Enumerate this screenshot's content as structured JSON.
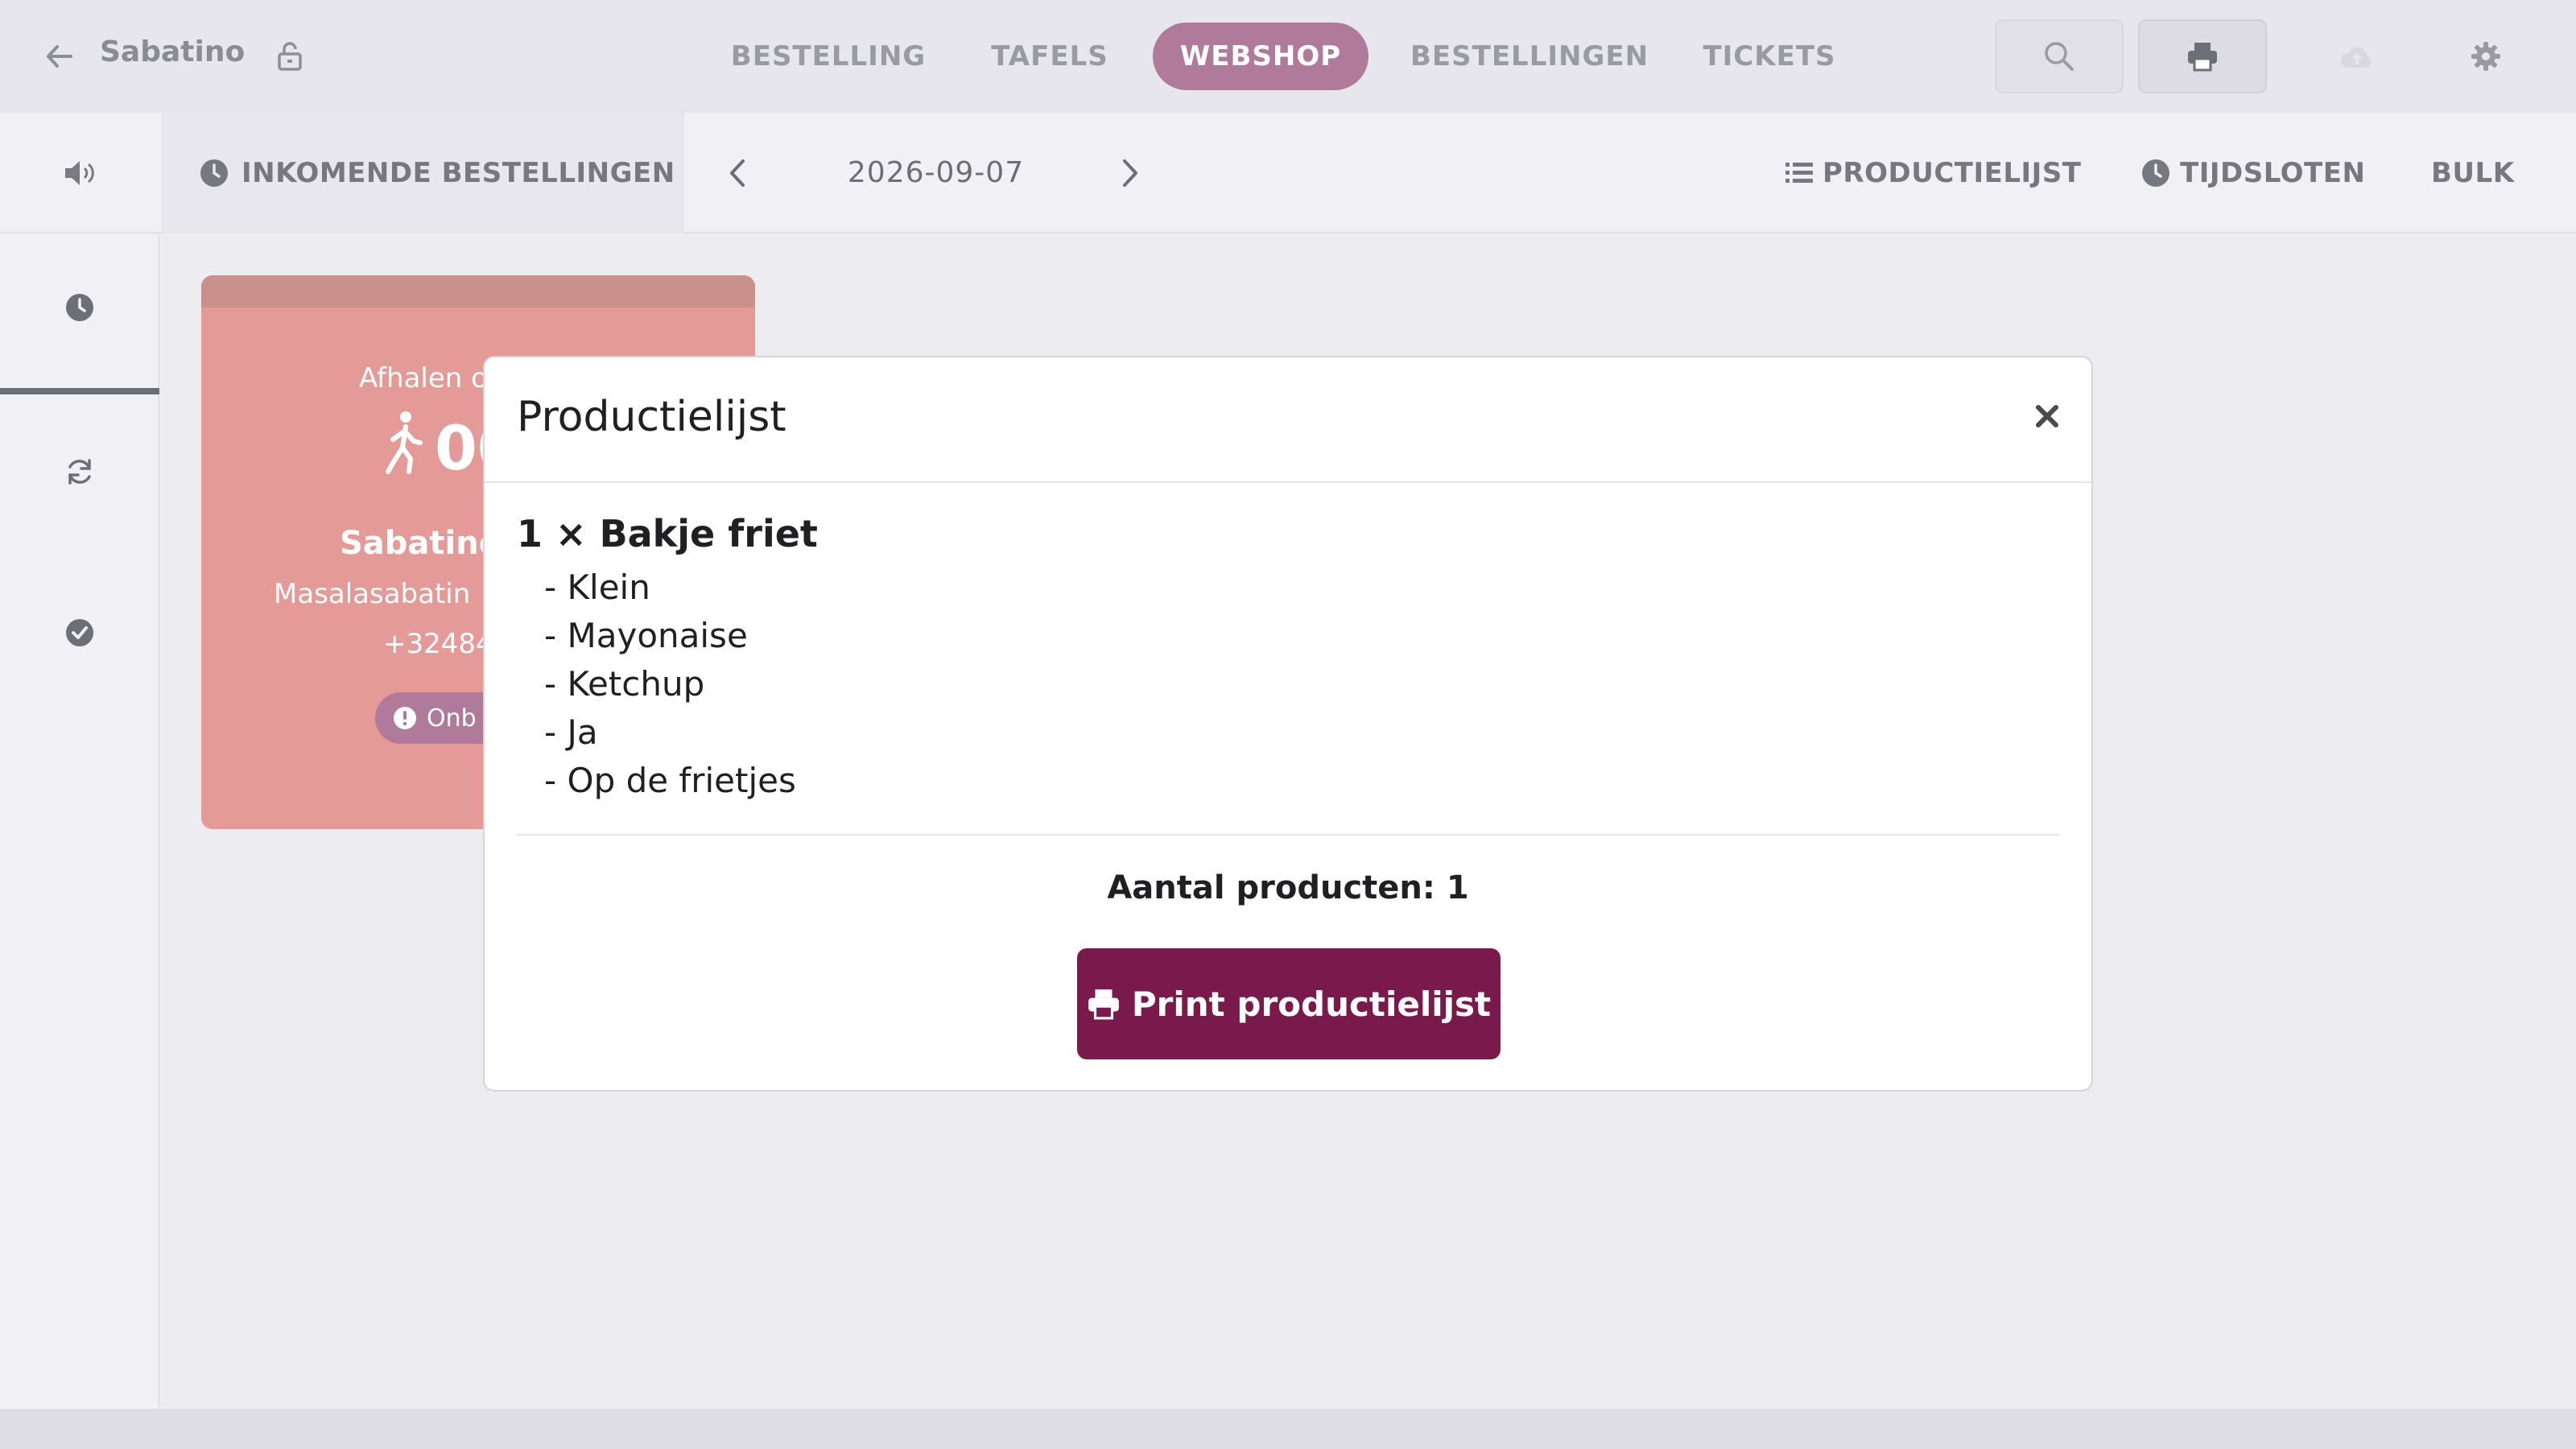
{
  "header": {
    "back_icon": "arrow-left-icon",
    "brand": "Sabatino",
    "lock_icon": "lock-open-icon",
    "tabs": [
      {
        "label": "BESTELLING",
        "active": false
      },
      {
        "label": "TAFELS",
        "active": false
      },
      {
        "label": "WEBSHOP",
        "active": true
      },
      {
        "label": "BESTELLINGEN",
        "active": false
      },
      {
        "label": "TICKETS",
        "active": false
      }
    ],
    "actions": [
      "search-icon",
      "printer-icon",
      "cloud-upload-icon",
      "gear-icon"
    ]
  },
  "subbar": {
    "speaker_icon": "volume-icon",
    "incoming_label": "INKOMENDE BESTELLINGEN",
    "date": "2026-09-07",
    "productlist_label": "PRODUCTIELIJST",
    "timeslots_label": "TIJDSLOTEN",
    "bulk_label": "BULK"
  },
  "rail": {
    "items": [
      "clock-icon",
      "refresh-icon",
      "check-circle-icon"
    ],
    "active_index": 0
  },
  "order_card": {
    "pickup_label": "Afhalen o",
    "time": "00",
    "customer": "Sabatino",
    "email": "Masalasabatin",
    "phone": "+32484",
    "badge": "Onb"
  },
  "modal": {
    "title": "Productielijst",
    "product": "1 × Bakje friet",
    "options": [
      "- Klein",
      "- Mayonaise",
      "- Ketchup",
      "- Ja",
      "- Op de frietjes"
    ],
    "count": "Aantal producten: 1",
    "print_button": "Print productielijst"
  },
  "colors": {
    "accent": "#b07a9a",
    "primary_button": "#7a1a4c",
    "card": "#e49a97"
  }
}
